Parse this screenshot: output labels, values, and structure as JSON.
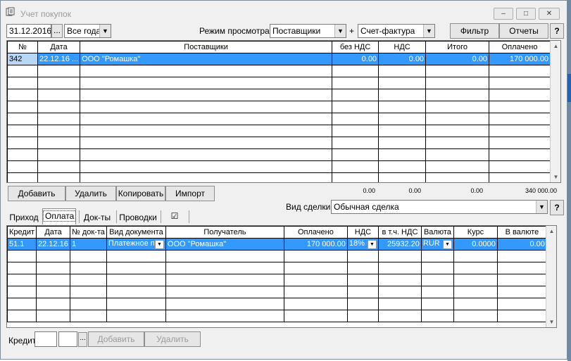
{
  "window": {
    "title": "Учет покупок",
    "controls": {
      "minimize": "–",
      "maximize": "□",
      "close": "✕"
    }
  },
  "toolbar": {
    "date": "31.12.2016",
    "date_picker": "...",
    "period": "Все года",
    "view_mode_label": "Режим просмотра:",
    "view_mode": "Поставщики",
    "plus": "+",
    "doc_type": "Счет-фактура",
    "filter_label": "Фильтр",
    "reports_label": "Отчеты",
    "help": "?"
  },
  "top_table": {
    "columns": [
      "№",
      "Дата",
      "Поставщики",
      "без НДС",
      "НДС",
      "Итого",
      "Оплачено"
    ],
    "rows": [
      {
        "num": "342",
        "date": "22.12.16",
        "more": "...",
        "supplier": "ООО \"Ромашка\"",
        "no_vat": "0.00",
        "vat": "0.00",
        "total": "0.00",
        "paid": "170 000.00"
      }
    ],
    "totals": {
      "no_vat": "0.00",
      "vat": "0.00",
      "total": "0.00",
      "paid": "340 000.00"
    }
  },
  "top_buttons": {
    "add": "Добавить",
    "delete": "Удалить",
    "copy": "Копировать",
    "import": "Импорт"
  },
  "deal": {
    "label": "Вид сделки",
    "value": "Обычная сделка",
    "help": "?"
  },
  "tabs": [
    {
      "label": "Приход"
    },
    {
      "label": "Оплата"
    },
    {
      "label": "Док-ты"
    },
    {
      "label": "Проводки"
    },
    {
      "label": "☑"
    }
  ],
  "bottom_table": {
    "columns": [
      "Кредит",
      "Дата",
      "№ док-та",
      "Вид документа",
      "Получатель",
      "Оплачено",
      "НДС",
      "в т.ч. НДС",
      "Валюта",
      "Курс",
      "В валюте"
    ],
    "rows": [
      {
        "credit": "51.1",
        "date": "22.12.16",
        "docnum": "1",
        "doctype": "Платежное п",
        "recipient": "ООО \"Ромашка\"",
        "paid": "170 000.00",
        "vat": "18%",
        "incl_vat": "25932.20",
        "currency": "RUR",
        "rate": "0.0000",
        "in_currency": "0.00"
      }
    ]
  },
  "footer": {
    "credit_label": "Кредит",
    "picker": "...",
    "add": "Добавить",
    "delete": "Удалить"
  }
}
